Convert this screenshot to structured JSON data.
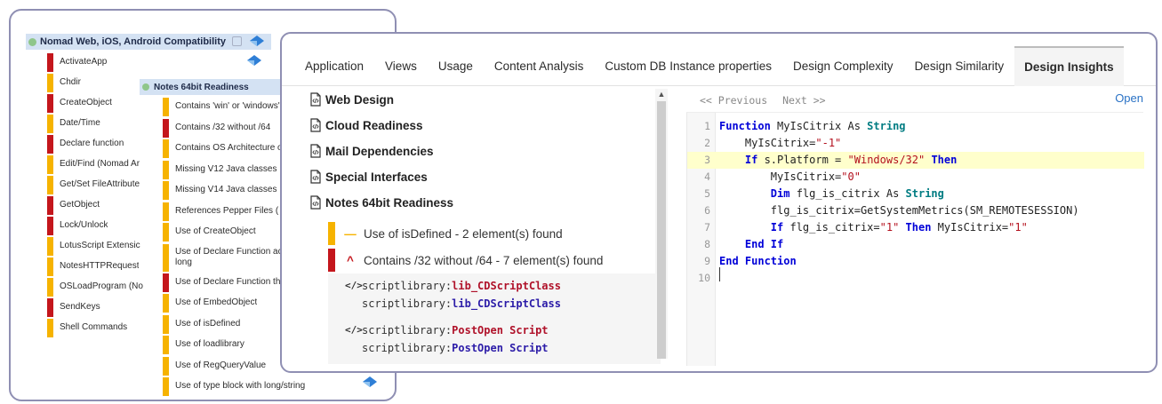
{
  "back_panel": {
    "root_label": "Nomad Web, iOS, Android Compatibility",
    "functions": [
      {
        "label": "ActivateApp",
        "color": "#c4161c"
      },
      {
        "label": "Chdir",
        "color": "#f6b300"
      },
      {
        "label": "CreateObject",
        "color": "#c4161c"
      },
      {
        "label": "Date/Time",
        "color": "#f6b300"
      },
      {
        "label": "Declare function",
        "color": "#c4161c"
      },
      {
        "label": "Edit/Find (Nomad Ar",
        "color": "#f6b300"
      },
      {
        "label": "Get/Set FileAttribute",
        "color": "#f6b300"
      },
      {
        "label": "GetObject",
        "color": "#c4161c"
      },
      {
        "label": "Lock/Unlock",
        "color": "#c4161c"
      },
      {
        "label": "LotusScript Extensic",
        "color": "#f6b300"
      },
      {
        "label": "NotesHTTPRequest",
        "color": "#f6b300"
      },
      {
        "label": "OSLoadProgram (No",
        "color": "#f6b300"
      },
      {
        "label": "SendKeys",
        "color": "#c4161c"
      },
      {
        "label": "Shell Commands",
        "color": "#f6b300"
      }
    ],
    "notes_header": "Notes 64bit Readiness",
    "checks": [
      {
        "label": "Contains 'win' or 'windows'",
        "color": "#f6b300",
        "tall": false
      },
      {
        "label": "Contains /32 without /64",
        "color": "#c4161c",
        "tall": false
      },
      {
        "label": "Contains OS Architecture o",
        "color": "#f6b300",
        "tall": false
      },
      {
        "label": "Missing V12 Java classes",
        "color": "#f6b300",
        "tall": false
      },
      {
        "label": "Missing V14 Java classes",
        "color": "#f6b300",
        "tall": false
      },
      {
        "label": "References Pepper Files (",
        "color": "#f6b300",
        "tall": false
      },
      {
        "label": "Use of CreateObject",
        "color": "#f6b300",
        "tall": false
      },
      {
        "label": "Use of Declare Function acc long",
        "color": "#f6b300",
        "tall": true
      },
      {
        "label": "Use of Declare Function tha",
        "color": "#c4161c",
        "tall": false
      },
      {
        "label": "Use of EmbedObject",
        "color": "#f6b300",
        "tall": false
      },
      {
        "label": "Use of isDefined",
        "color": "#f6b300",
        "tall": false
      },
      {
        "label": "Use of loadlibrary",
        "color": "#f6b300",
        "tall": false
      },
      {
        "label": "Use of RegQueryValue",
        "color": "#f6b300",
        "tall": false
      },
      {
        "label": "Use of type block with long/string",
        "color": "#f6b300",
        "tall": false
      }
    ]
  },
  "tabs": [
    {
      "label": "Application",
      "active": false
    },
    {
      "label": "Views",
      "active": false
    },
    {
      "label": "Usage",
      "active": false
    },
    {
      "label": "Content Analysis",
      "active": false
    },
    {
      "label": "Custom DB Instance properties",
      "active": false
    },
    {
      "label": "Design Complexity",
      "active": false
    },
    {
      "label": "Design Similarity",
      "active": false
    },
    {
      "label": "Design Insights",
      "active": true
    }
  ],
  "insights": {
    "categories": [
      "Web Design",
      "Cloud Readiness",
      "Mail Dependencies",
      "Special Interfaces",
      "Notes 64bit Readiness"
    ],
    "findings": [
      {
        "label": "Use of isDefined - 2 element(s) found",
        "icon": "—",
        "color": "#f6b300"
      },
      {
        "label": "Contains /32 without /64 - 7 element(s) found",
        "icon": "^",
        "color": "#c4161c"
      }
    ],
    "refs": [
      {
        "tag": "</>",
        "prefix": "scriptlibrary:",
        "name_red": "lib_CDScriptClass",
        "name_blue": "lib_CDScriptClass"
      },
      {
        "tag": "</>",
        "prefix": "scriptlibrary:",
        "name_red": "PostOpen Script",
        "name_blue": "PostOpen Script"
      }
    ]
  },
  "code_panel": {
    "prev_label": "<< Previous",
    "next_label": "Next >>",
    "open_label": "Open",
    "line_numbers": [
      "1",
      "2",
      "3",
      "4",
      "5",
      "6",
      "7",
      "8",
      "9",
      "10"
    ],
    "highlight_line": 3
  }
}
